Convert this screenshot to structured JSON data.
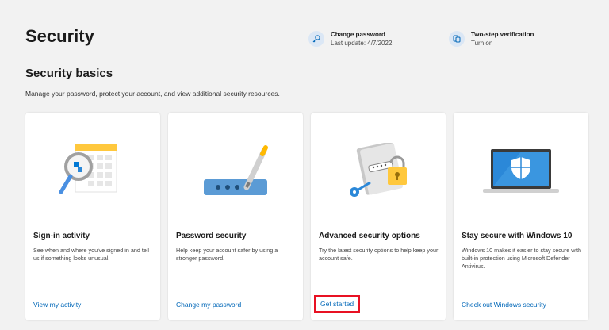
{
  "header": {
    "title": "Security",
    "change_password": {
      "title": "Change password",
      "subtitle": "Last update: 4/7/2022",
      "icon": "key-icon"
    },
    "two_step": {
      "title": "Two-step verification",
      "subtitle": "Turn on",
      "icon": "phone-verification-icon"
    }
  },
  "section": {
    "title": "Security basics",
    "description": "Manage your password, protect your account, and view additional security resources."
  },
  "cards": [
    {
      "title": "Sign-in activity",
      "description": "See when and where you've signed in and tell us if something looks unusual.",
      "link": "View my activity",
      "icon": "sign-in-activity-illustration"
    },
    {
      "title": "Password security",
      "description": "Help keep your account safer by using a stronger password.",
      "link": "Change my password",
      "icon": "password-illustration"
    },
    {
      "title": "Advanced security options",
      "description": "Try the latest security options to help keep your account safe.",
      "link": "Get started",
      "icon": "advanced-security-illustration"
    },
    {
      "title": "Stay secure with Windows 10",
      "description": "Windows 10 makes it easier to stay secure with built-in protection using Microsoft Defender Antivirus.",
      "link": "Check out Windows security",
      "icon": "windows-security-illustration"
    }
  ],
  "colors": {
    "link": "#0067b8",
    "highlight": "#e81123",
    "background": "#f2f2f2"
  }
}
